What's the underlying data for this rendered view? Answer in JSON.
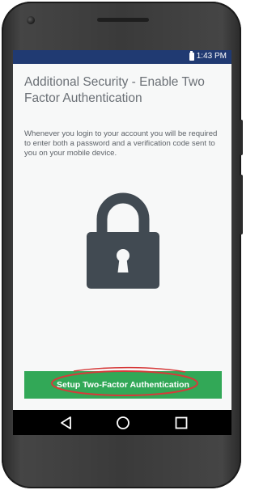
{
  "status_bar": {
    "time": "1:43 PM",
    "battery_icon": "battery-icon",
    "background": "#203a72"
  },
  "screen": {
    "title": "Additional Security - Enable Two Factor Authentication",
    "description": "Whenever you login to your account you will be required to enter both a password and a verification code sent to you on your mobile device.",
    "illustration_icon": "lock-icon",
    "lock_color": "#414a52"
  },
  "cta": {
    "label": "Setup Two-Factor Authentication",
    "color": "#32a857",
    "annotation_color": "#d63a3a"
  },
  "nav_bar": {
    "icons": [
      "back-icon",
      "home-icon",
      "recent-apps-icon"
    ]
  }
}
